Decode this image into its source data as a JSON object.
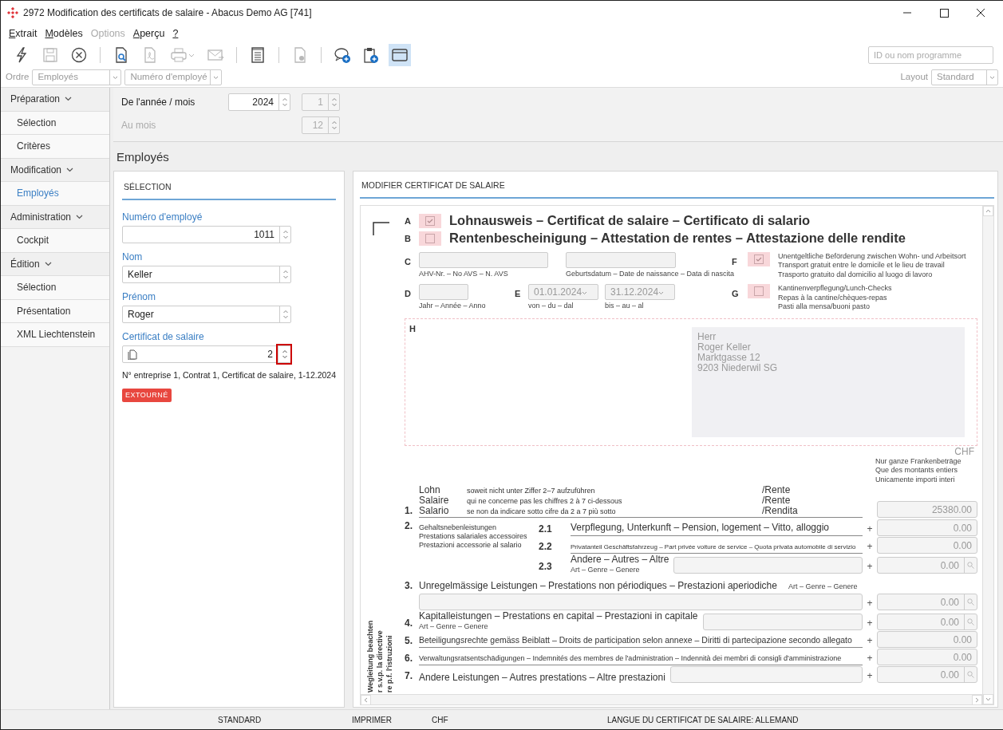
{
  "window": {
    "title": "2972 Modification des certificats de salaire - Abacus Demo AG [741]"
  },
  "menu": [
    {
      "label": "Extrait",
      "disabled": false
    },
    {
      "label": "Modèles",
      "disabled": false
    },
    {
      "label": "Options",
      "disabled": true
    },
    {
      "label": "Aperçu",
      "disabled": false
    },
    {
      "label": "?",
      "disabled": false
    }
  ],
  "toolbar": {
    "groups": [
      {
        "buttons": [
          {
            "kind": "lightning",
            "disabled": false,
            "selected": false
          },
          {
            "kind": "save",
            "disabled": true,
            "selected": false
          },
          {
            "kind": "cancel",
            "disabled": false,
            "selected": false
          }
        ]
      },
      {
        "buttons": [
          {
            "kind": "preview",
            "disabled": false,
            "selected": false
          },
          {
            "kind": "pdf",
            "disabled": true,
            "selected": false
          },
          {
            "kind": "print",
            "disabled": true,
            "selected": false
          },
          {
            "kind": "mail",
            "disabled": true,
            "selected": false
          }
        ]
      },
      {
        "buttons": [
          {
            "kind": "notepad",
            "disabled": false,
            "selected": false
          }
        ]
      },
      {
        "buttons": [
          {
            "kind": "doc-gear",
            "disabled": true,
            "selected": false
          }
        ]
      },
      {
        "buttons": [
          {
            "kind": "comment-add",
            "disabled": false,
            "selected": false
          },
          {
            "kind": "clipboard-add",
            "disabled": false,
            "selected": false
          },
          {
            "kind": "window",
            "disabled": false,
            "selected": true
          }
        ]
      }
    ]
  },
  "program_search": {
    "placeholder": "ID ou nom programme"
  },
  "order": {
    "label": "Ordre",
    "disabled": true,
    "fields": [
      "Employés",
      "Numéro d'employé"
    ]
  },
  "layout": {
    "label": "Layout",
    "value": "Standard"
  },
  "sidebar": {
    "groups": [
      {
        "label": "Préparation",
        "expanded": true,
        "children": [
          {
            "label": "Sélection",
            "selected": false
          },
          {
            "label": "Critères",
            "selected": false
          }
        ]
      },
      {
        "label": "Modification",
        "expanded": true,
        "children": [
          {
            "label": "Employés",
            "selected": true
          }
        ]
      },
      {
        "label": "Administration",
        "expanded": true,
        "children": [
          {
            "label": "Cockpit",
            "selected": false
          }
        ]
      },
      {
        "label": "Édition",
        "expanded": true,
        "children": [
          {
            "label": "Sélection",
            "selected": false
          },
          {
            "label": "Présentation",
            "selected": false
          },
          {
            "label": "XML Liechtenstein",
            "selected": false
          }
        ]
      }
    ]
  },
  "period": [
    {
      "label": "De l'année / mois",
      "disabled": false,
      "year": {
        "value": "2024",
        "disabled": false
      },
      "month": {
        "value": "1",
        "disabled": true
      }
    },
    {
      "label": "Au mois",
      "disabled": true,
      "month": {
        "value": "12",
        "disabled": true
      }
    }
  ],
  "section_title": "Employés",
  "selection": {
    "title": "SÉLECTION",
    "fields": [
      {
        "label": "Numéro d'employé",
        "value": "1011",
        "kind": "number",
        "highlighted": false
      },
      {
        "label": "Nom",
        "value": "Keller",
        "kind": "text",
        "highlighted": false
      },
      {
        "label": "Prénom",
        "value": "Roger",
        "kind": "text",
        "highlighted": false
      },
      {
        "label": "Certificat de salaire",
        "value": "2",
        "kind": "document",
        "highlighted": true
      }
    ],
    "info": "N° entreprise 1, Contrat 1, Certificat de salaire, 1-12.2024",
    "badge": "EXTOURNÉ"
  },
  "certificate": {
    "title": "MODIFIER CERTIFICAT DE SALAIRE",
    "types": [
      {
        "letter": "A",
        "label": "Lohnausweis – Certificat de salaire – Certificato di salario",
        "checked": true
      },
      {
        "letter": "B",
        "label": "Rentenbescheinigung – Attestation de rentes – Attestazione delle rendite",
        "checked": false
      }
    ],
    "c": {
      "letter": "C",
      "fields": [
        {
          "caption": "AHV-Nr. – No AVS – N. AVS"
        },
        {
          "caption": "Geburtsdatum – Date de naissance – Data di nascita"
        }
      ]
    },
    "d": {
      "letter": "D",
      "caption": "Jahr – Année – Anno"
    },
    "e": {
      "letter": "E",
      "dates": [
        {
          "value": "01.01.2024",
          "caption": "von – du – dal"
        },
        {
          "value": "31.12.2024",
          "caption": "bis – au – al"
        }
      ]
    },
    "options": [
      {
        "letter": "F",
        "checked": true,
        "lines": [
          "Unentgeltliche Beförderung zwischen Wohn- und Arbeitsort",
          "Transport gratuit entre le domicile et le lieu de travail",
          "Trasporto gratuito dal domicilio al luogo di lavoro"
        ]
      },
      {
        "letter": "G",
        "checked": false,
        "lines": [
          "Kantinenverpflegung/Lunch-Checks",
          "Repas à la cantine/chèques-repas",
          "Pasti alla mensa/buoni pasto"
        ]
      }
    ],
    "h": {
      "letter": "H",
      "address": [
        "Herr",
        "Roger Keller",
        "Marktgasse 12",
        "9203 Niederwil SG"
      ]
    },
    "currency": "CHF",
    "amount_note": [
      "Nur ganze Frankenbeträge",
      "Que des montants entiers",
      "Unicamente importi interi"
    ],
    "items": [
      {
        "number": "1.",
        "kind": "salary",
        "lines": [
          {
            "label": "Lohn",
            "note": "soweit nicht unter Ziffer 2–7 aufzuführen",
            "suffix": "/Rente"
          },
          {
            "label": "Salaire",
            "note": "qui ne concerne pas les chiffres 2 à 7 ci-dessous",
            "suffix": "/Rente"
          },
          {
            "label": "Salario",
            "note": "se non da indicare sotto cifre da 2 a 7 più sotto",
            "suffix": "/Rendita"
          }
        ],
        "amount": "25380.00",
        "lookup": false
      },
      {
        "number": "2.",
        "kind": "group",
        "labels": [
          "Gehaltsnebenleistungen",
          "Prestations salariales accessoires",
          "Prestazioni accessorie al salario"
        ],
        "subitems": [
          {
            "number": "2.1",
            "kind": "plain",
            "label": "Verpflegung, Unterkunft – Pension, logement – Vitto, alloggio",
            "sign": "+",
            "amount": "0.00",
            "lookup": false
          },
          {
            "number": "2.2",
            "kind": "plain",
            "label": "Privatanteil Geschäftsfahrzeug – Part privée voiture de service – Quota privata automobile di servizio",
            "sign": "+",
            "amount": "0.00",
            "lookup": false
          },
          {
            "number": "2.3",
            "kind": "with_field",
            "label": "Andere – Autres – Altre",
            "caption": "Art – Genre – Genere",
            "sign": "+",
            "amount": "0.00",
            "lookup": true
          }
        ]
      },
      {
        "number": "3.",
        "kind": "field_below",
        "label": "Unregelmässige Leistungen – Prestations non périodiques – Prestazioni aperiodiche",
        "caption": "Art – Genre – Genere",
        "sign": "+",
        "amount": "0.00",
        "lookup": true
      },
      {
        "number": "4.",
        "kind": "with_field",
        "label": "Kapitalleistungen – Prestations en capital – Prestazioni in capitale",
        "caption": "Art – Genre – Genere",
        "sign": "+",
        "amount": "0.00",
        "lookup": true
      },
      {
        "number": "5.",
        "kind": "plain",
        "label": "Beteiligungsrechte gemäss Beiblatt – Droits de participation selon annexe – Diritti di partecipazione secondo allegato",
        "sign": "+",
        "amount": "0.00",
        "lookup": false
      },
      {
        "number": "6.",
        "kind": "plain",
        "label": "Verwaltungsratsentschädigungen – Indemnités des membres de l'administration – Indennità dei membri di consigli d'amministrazione",
        "sign": "+",
        "amount": "0.00",
        "lookup": false
      },
      {
        "number": "7.",
        "kind": "with_field",
        "label": "Andere Leistungen – Autres prestations – Altre prestazioni",
        "sign": "+",
        "amount": "0.00",
        "lookup": true
      }
    ],
    "instruction_note": [
      "Wegleitung beachten",
      "r s.v.p. la directive",
      "re p.f. l'istruzioni"
    ]
  },
  "status_bar": [
    "STANDARD",
    "IMPRIMER",
    "CHF",
    "LANGUE DU CERTIFICAT DE SALAIRE: ALLEMAND"
  ]
}
